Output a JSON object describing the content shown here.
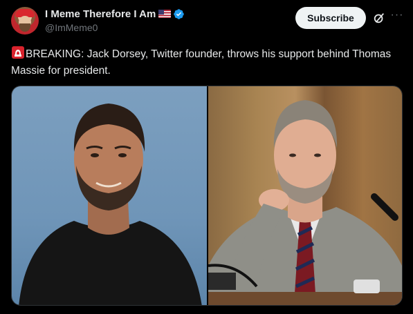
{
  "author": {
    "name": "I Meme Therefore I Am",
    "handle": "@ImMeme0",
    "flag_icon": "us-flag-icon",
    "verified_icon": "verified-badge-icon"
  },
  "actions": {
    "subscribe_label": "Subscribe",
    "grok_icon": "grok-icon",
    "more_label": "···"
  },
  "tweet": {
    "emoji": "siren-emoji",
    "text": "BREAKING: Jack Dorsey, Twitter founder, throws his support behind Thomas Massie for president."
  },
  "colors": {
    "accent": "#1d9bf0",
    "background": "#000000",
    "text": "#e7e9ea",
    "muted": "#71767b"
  }
}
